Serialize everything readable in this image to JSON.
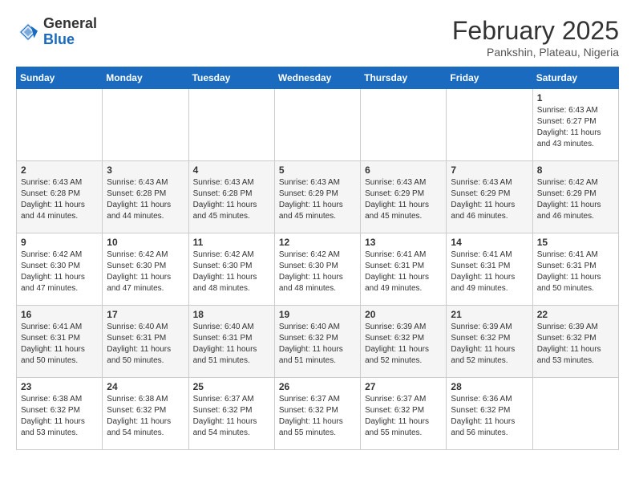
{
  "header": {
    "logo": {
      "general": "General",
      "blue": "Blue"
    },
    "title": "February 2025",
    "location": "Pankshin, Plateau, Nigeria"
  },
  "days_of_week": [
    "Sunday",
    "Monday",
    "Tuesday",
    "Wednesday",
    "Thursday",
    "Friday",
    "Saturday"
  ],
  "weeks": [
    [
      null,
      null,
      null,
      null,
      null,
      null,
      {
        "day": 1,
        "sunrise": "6:43 AM",
        "sunset": "6:27 PM",
        "daylight": "11 hours and 43 minutes."
      }
    ],
    [
      {
        "day": 2,
        "sunrise": "6:43 AM",
        "sunset": "6:28 PM",
        "daylight": "11 hours and 44 minutes."
      },
      {
        "day": 3,
        "sunrise": "6:43 AM",
        "sunset": "6:28 PM",
        "daylight": "11 hours and 44 minutes."
      },
      {
        "day": 4,
        "sunrise": "6:43 AM",
        "sunset": "6:28 PM",
        "daylight": "11 hours and 45 minutes."
      },
      {
        "day": 5,
        "sunrise": "6:43 AM",
        "sunset": "6:29 PM",
        "daylight": "11 hours and 45 minutes."
      },
      {
        "day": 6,
        "sunrise": "6:43 AM",
        "sunset": "6:29 PM",
        "daylight": "11 hours and 45 minutes."
      },
      {
        "day": 7,
        "sunrise": "6:43 AM",
        "sunset": "6:29 PM",
        "daylight": "11 hours and 46 minutes."
      },
      {
        "day": 8,
        "sunrise": "6:42 AM",
        "sunset": "6:29 PM",
        "daylight": "11 hours and 46 minutes."
      }
    ],
    [
      {
        "day": 9,
        "sunrise": "6:42 AM",
        "sunset": "6:30 PM",
        "daylight": "11 hours and 47 minutes."
      },
      {
        "day": 10,
        "sunrise": "6:42 AM",
        "sunset": "6:30 PM",
        "daylight": "11 hours and 47 minutes."
      },
      {
        "day": 11,
        "sunrise": "6:42 AM",
        "sunset": "6:30 PM",
        "daylight": "11 hours and 48 minutes."
      },
      {
        "day": 12,
        "sunrise": "6:42 AM",
        "sunset": "6:30 PM",
        "daylight": "11 hours and 48 minutes."
      },
      {
        "day": 13,
        "sunrise": "6:41 AM",
        "sunset": "6:31 PM",
        "daylight": "11 hours and 49 minutes."
      },
      {
        "day": 14,
        "sunrise": "6:41 AM",
        "sunset": "6:31 PM",
        "daylight": "11 hours and 49 minutes."
      },
      {
        "day": 15,
        "sunrise": "6:41 AM",
        "sunset": "6:31 PM",
        "daylight": "11 hours and 50 minutes."
      }
    ],
    [
      {
        "day": 16,
        "sunrise": "6:41 AM",
        "sunset": "6:31 PM",
        "daylight": "11 hours and 50 minutes."
      },
      {
        "day": 17,
        "sunrise": "6:40 AM",
        "sunset": "6:31 PM",
        "daylight": "11 hours and 50 minutes."
      },
      {
        "day": 18,
        "sunrise": "6:40 AM",
        "sunset": "6:31 PM",
        "daylight": "11 hours and 51 minutes."
      },
      {
        "day": 19,
        "sunrise": "6:40 AM",
        "sunset": "6:32 PM",
        "daylight": "11 hours and 51 minutes."
      },
      {
        "day": 20,
        "sunrise": "6:39 AM",
        "sunset": "6:32 PM",
        "daylight": "11 hours and 52 minutes."
      },
      {
        "day": 21,
        "sunrise": "6:39 AM",
        "sunset": "6:32 PM",
        "daylight": "11 hours and 52 minutes."
      },
      {
        "day": 22,
        "sunrise": "6:39 AM",
        "sunset": "6:32 PM",
        "daylight": "11 hours and 53 minutes."
      }
    ],
    [
      {
        "day": 23,
        "sunrise": "6:38 AM",
        "sunset": "6:32 PM",
        "daylight": "11 hours and 53 minutes."
      },
      {
        "day": 24,
        "sunrise": "6:38 AM",
        "sunset": "6:32 PM",
        "daylight": "11 hours and 54 minutes."
      },
      {
        "day": 25,
        "sunrise": "6:37 AM",
        "sunset": "6:32 PM",
        "daylight": "11 hours and 54 minutes."
      },
      {
        "day": 26,
        "sunrise": "6:37 AM",
        "sunset": "6:32 PM",
        "daylight": "11 hours and 55 minutes."
      },
      {
        "day": 27,
        "sunrise": "6:37 AM",
        "sunset": "6:32 PM",
        "daylight": "11 hours and 55 minutes."
      },
      {
        "day": 28,
        "sunrise": "6:36 AM",
        "sunset": "6:32 PM",
        "daylight": "11 hours and 56 minutes."
      },
      null
    ]
  ]
}
